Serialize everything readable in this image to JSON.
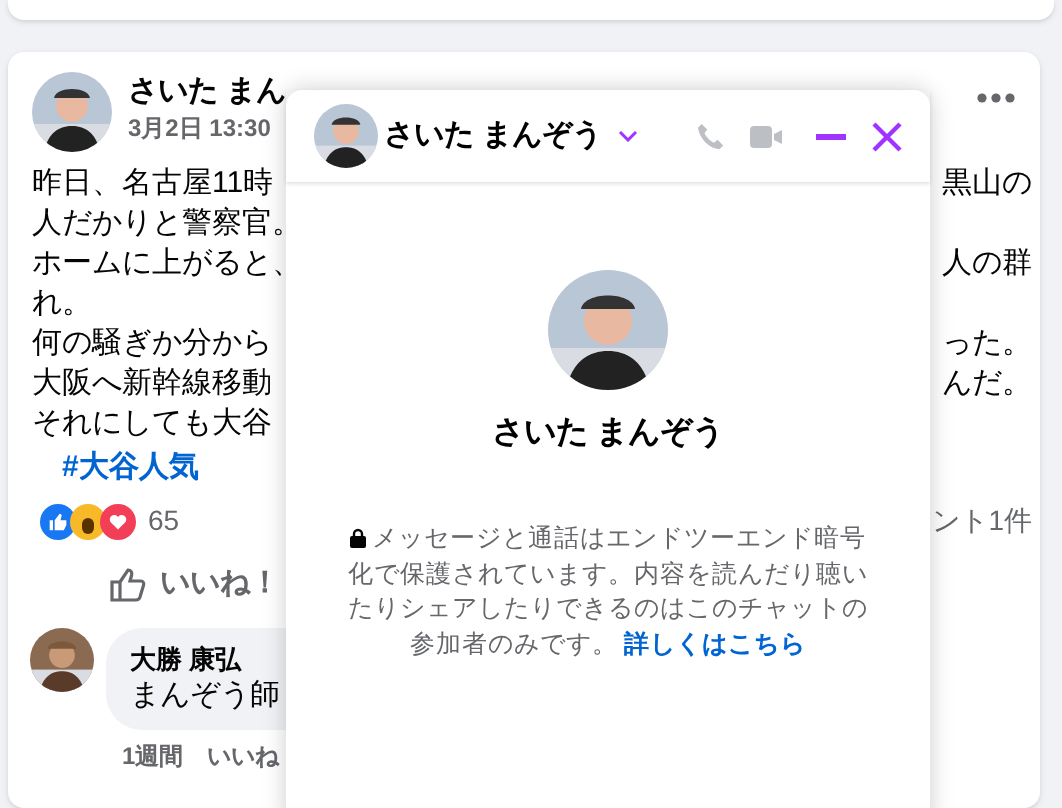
{
  "post": {
    "author": "さいた まん",
    "time": "3月2日 13:30",
    "lines": [
      {
        "left": "昨日、名古屋11時",
        "right": "黒山の"
      },
      {
        "left": "人だかりと警察官。"
      },
      {
        "left": "ホームに上がると、",
        "right": "人の群"
      },
      {
        "left": "れ。"
      },
      {
        "left": "何の騒ぎか分から",
        "right": "った。"
      },
      {
        "left": "大阪へ新幹線移動",
        "right": "んだ。"
      },
      {
        "left": "それにしても大谷"
      }
    ],
    "hashtag": "#大谷人気",
    "reaction_count": "65",
    "comment_count": "ント1件",
    "like_label": "いいね！"
  },
  "comment": {
    "author": "大勝 康弘",
    "text": "まんぞう師",
    "time": "1週間",
    "like": "いいね"
  },
  "chat": {
    "title": "さいた まんぞう",
    "name": "さいた まんぞう",
    "notice": "メッセージと通話はエンドツーエンド暗号化で保護されています。内容を読んだり聴いたりシェアしたりできるのはこのチャットの参加者のみです。",
    "link": "詳しくはこちら"
  }
}
